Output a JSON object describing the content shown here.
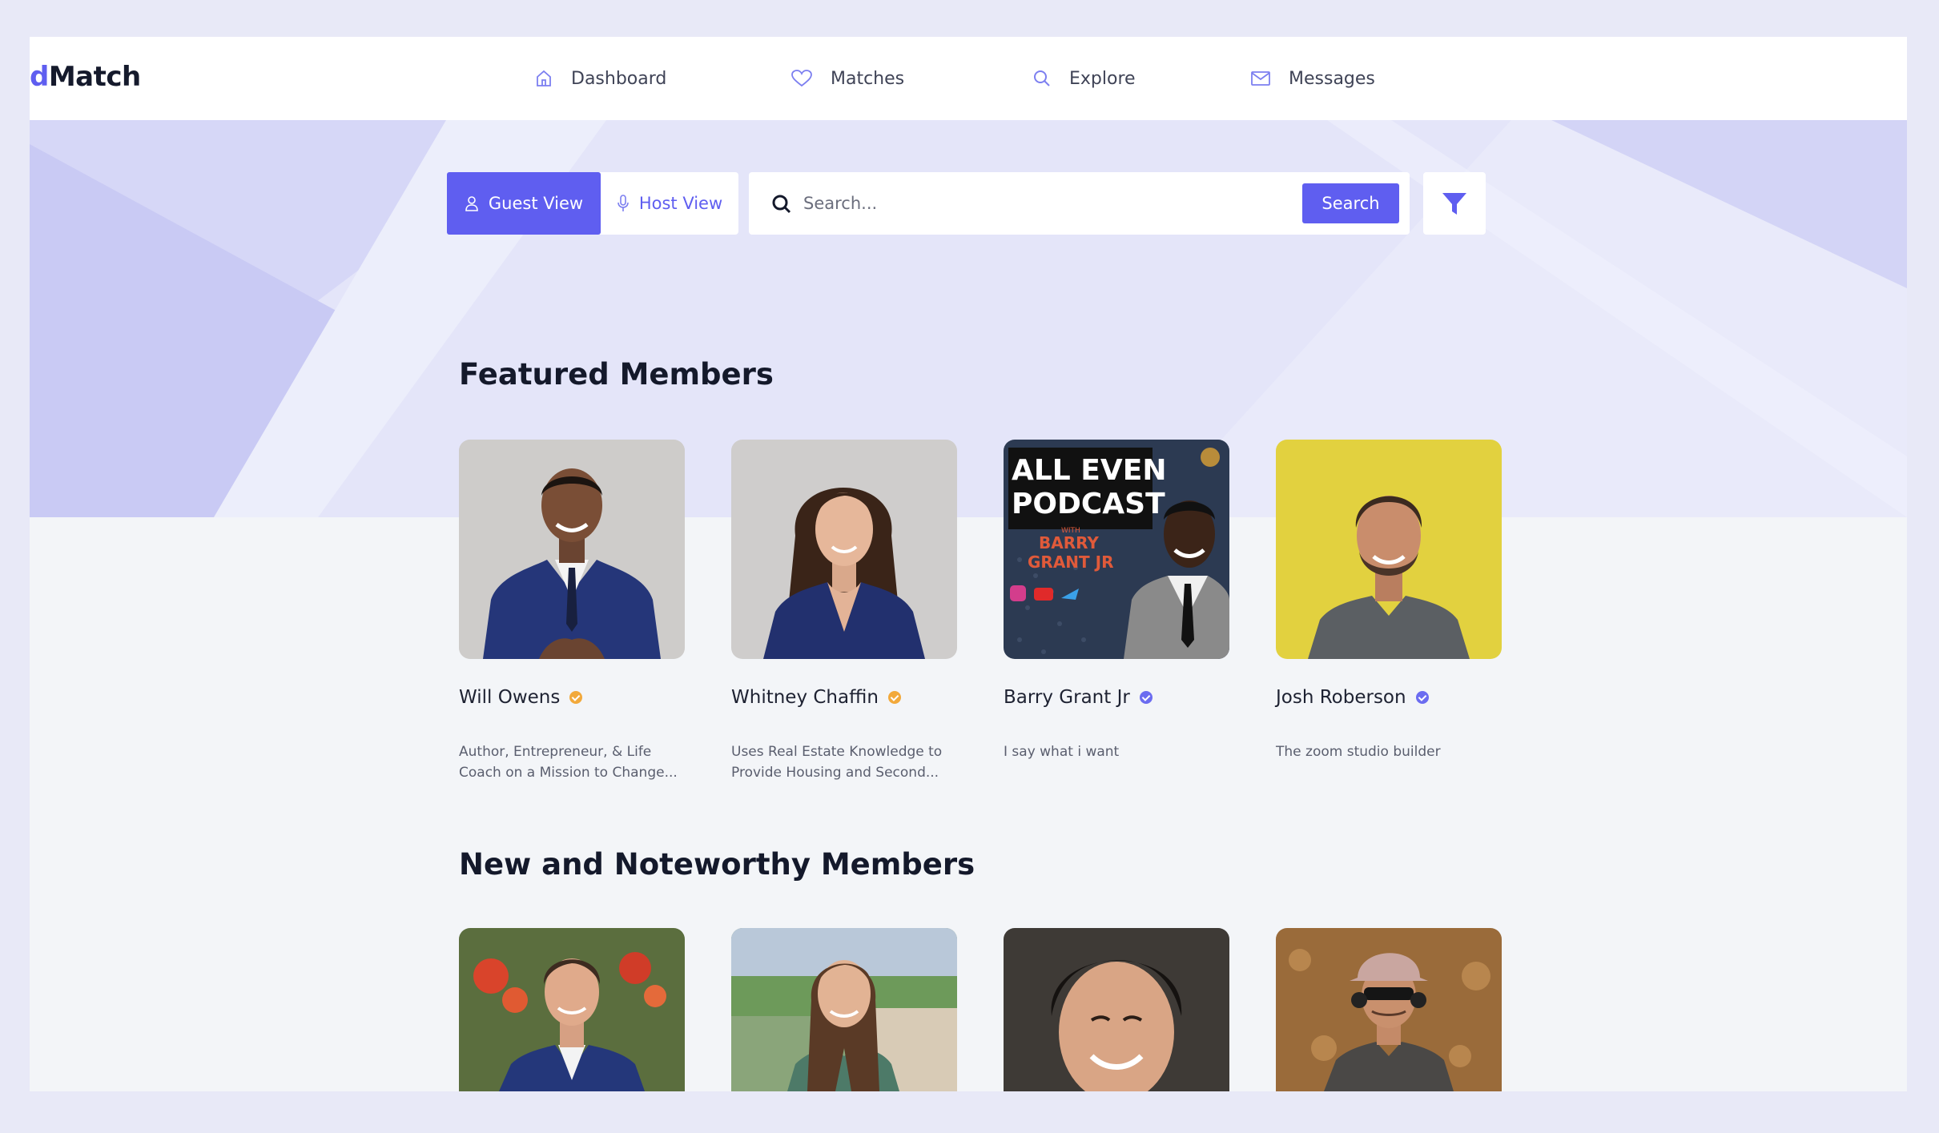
{
  "brand": {
    "logo_left": "d",
    "logo_right": "Match",
    "accent_color": "#5f5ef0"
  },
  "nav": [
    {
      "label": "Dashboard",
      "icon": "home-icon"
    },
    {
      "label": "Matches",
      "icon": "heart-icon"
    },
    {
      "label": "Explore",
      "icon": "search-icon"
    },
    {
      "label": "Messages",
      "icon": "mail-icon"
    }
  ],
  "toolbar": {
    "guest_view_label": "Guest View",
    "host_view_label": "Host View",
    "search_placeholder": "Search...",
    "search_button_label": "Search",
    "filter_icon": "filter-icon"
  },
  "featured": {
    "title": "Featured Members",
    "members": [
      {
        "name": "Will Owens",
        "verified_color": "#f2a93b",
        "bio_line1": "Author, Entrepreneur, & Life",
        "bio_line2": "Coach on a Mission to Change..."
      },
      {
        "name": "Whitney Chaffin",
        "verified_color": "#f2a93b",
        "bio_line1": "Uses Real Estate Knowledge to",
        "bio_line2": "Provide Housing and Second..."
      },
      {
        "name": "Barry Grant Jr",
        "verified_color": "#6b6cf0",
        "bio_line1": "I say what i want",
        "bio_line2": "",
        "cover_title_1": "ALL EVEN",
        "cover_title_2": "PODCAST",
        "cover_with": "WITH",
        "cover_host_1": "BARRY",
        "cover_host_2": "GRANT JR"
      },
      {
        "name": "Josh Roberson",
        "verified_color": "#6b6cf0",
        "bio_line1": "The zoom studio builder",
        "bio_line2": ""
      }
    ]
  },
  "noteworthy": {
    "title": "New and Noteworthy Members"
  }
}
